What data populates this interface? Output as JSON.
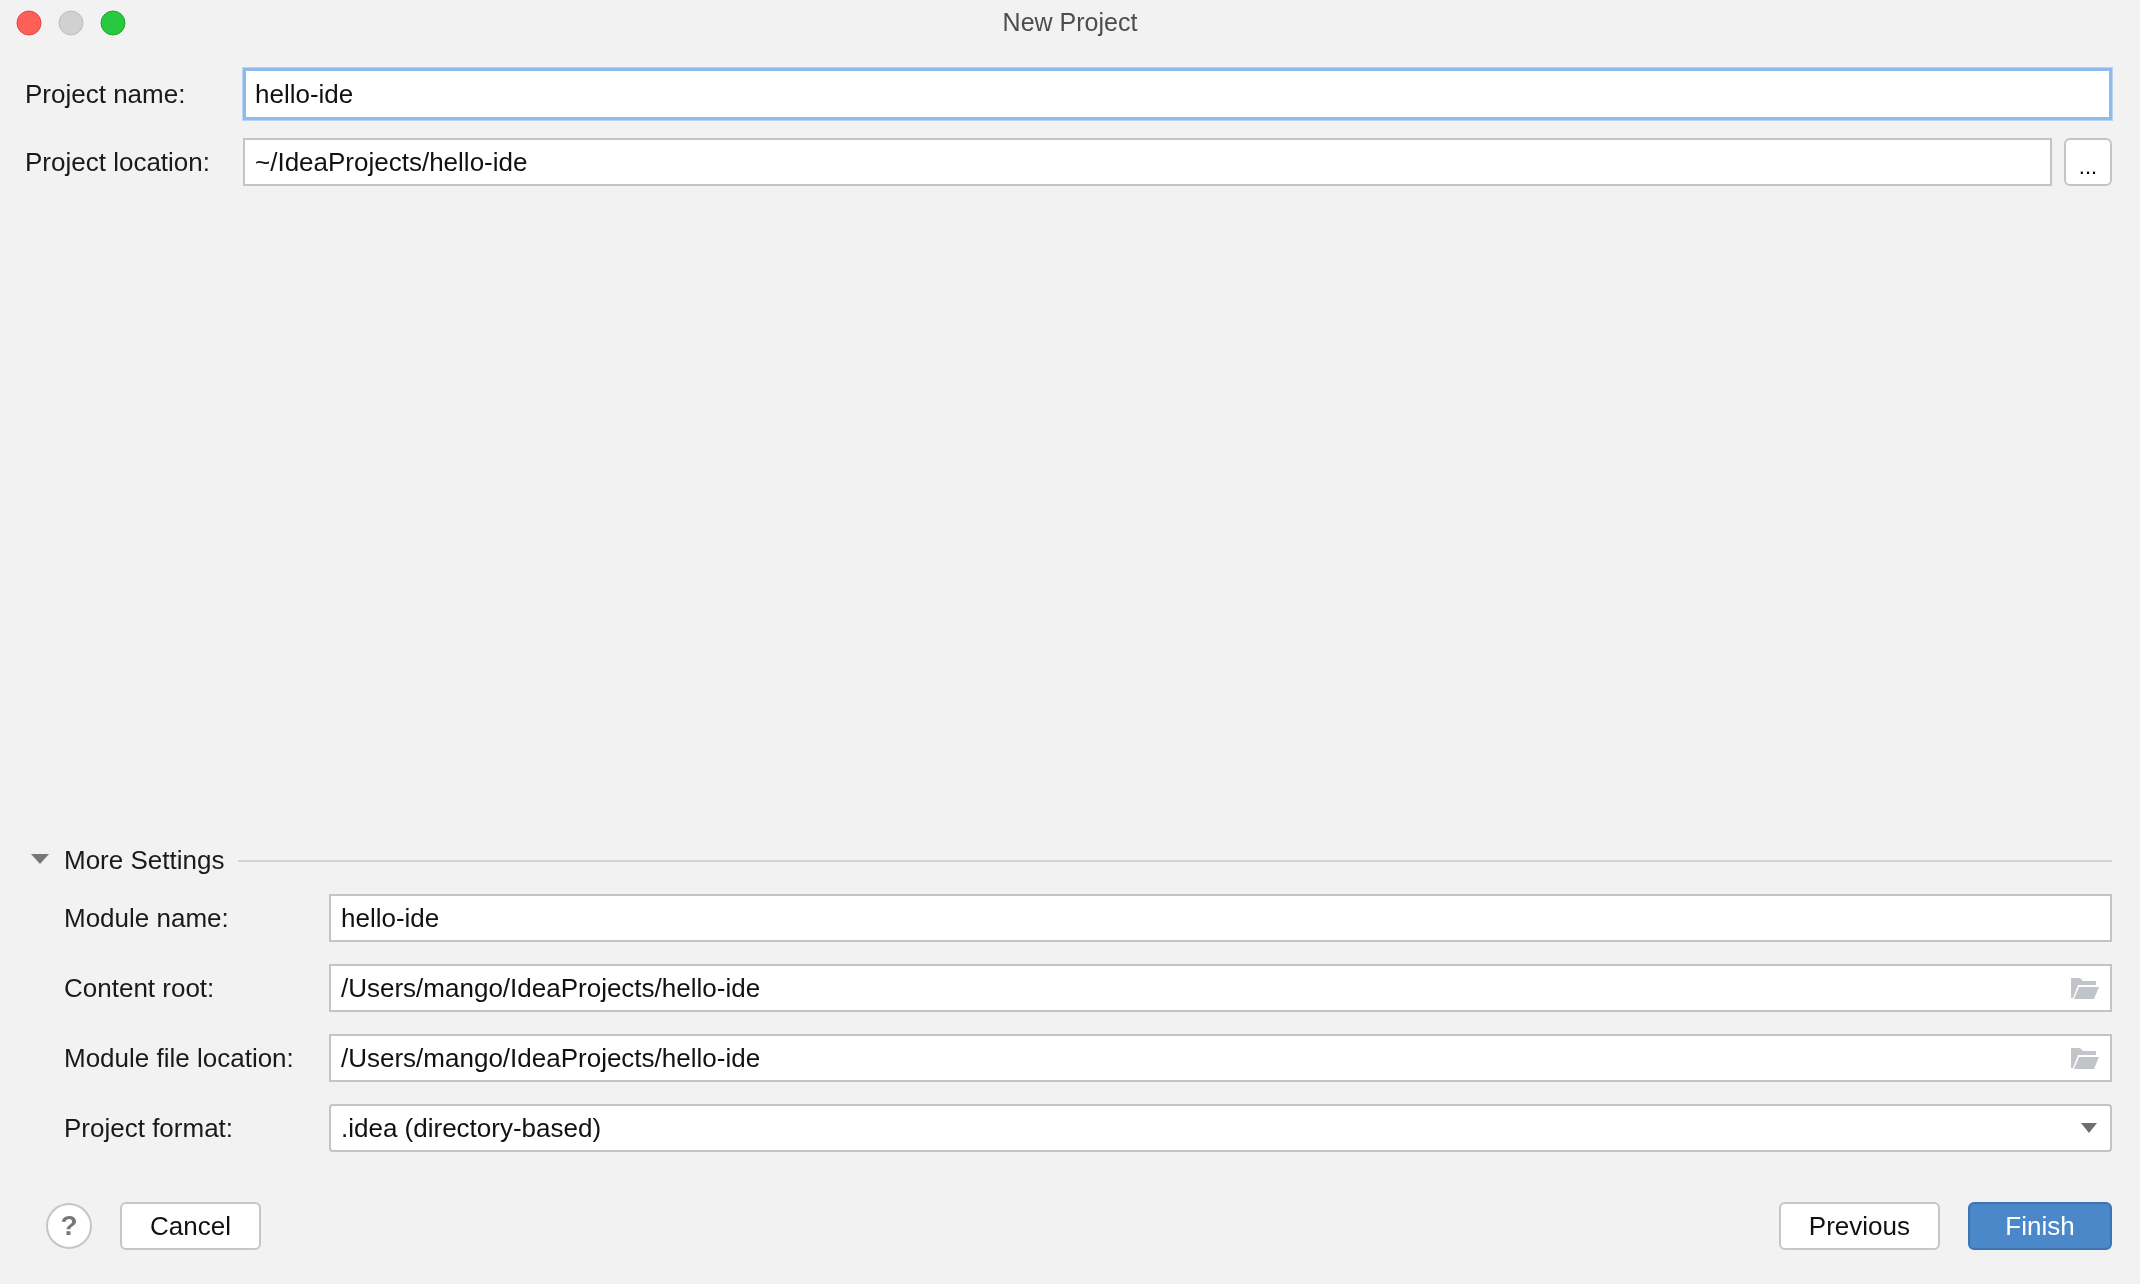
{
  "window": {
    "title": "New Project"
  },
  "fields": [
    {
      "label": "Project name:",
      "value": "hello-ide",
      "kind": "text",
      "focused": true
    },
    {
      "label": "Project location:",
      "value": "~/IdeaProjects/hello-ide",
      "kind": "browse",
      "focused": false,
      "browse": "..."
    }
  ],
  "more_settings": {
    "label": "More Settings",
    "expanded": true,
    "fields": [
      {
        "label": "Module name:",
        "value": "hello-ide",
        "kind": "text"
      },
      {
        "label": "Content root:",
        "value": "/Users/mango/IdeaProjects/hello-ide",
        "kind": "folder"
      },
      {
        "label": "Module file location:",
        "value": "/Users/mango/IdeaProjects/hello-ide",
        "kind": "folder"
      },
      {
        "label": "Project format:",
        "value": ".idea (directory-based)",
        "kind": "dropdown"
      }
    ]
  },
  "buttons": [
    {
      "label": "?",
      "kind": "help"
    },
    {
      "label": "Cancel",
      "kind": "default"
    },
    {
      "label": "Previous",
      "kind": "default"
    },
    {
      "label": "Finish",
      "kind": "primary"
    }
  ]
}
